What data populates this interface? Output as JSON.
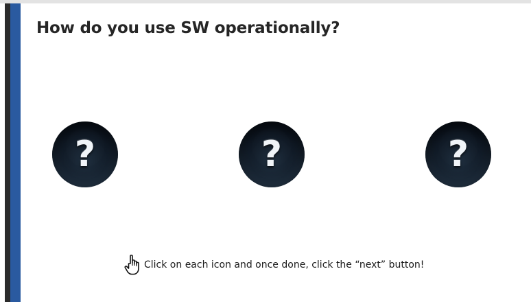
{
  "slide": {
    "title": "How do you use SW operationally?",
    "icons": [
      {
        "symbol": "?",
        "icon": "question-icon"
      },
      {
        "symbol": "?",
        "icon": "question-icon"
      },
      {
        "symbol": "?",
        "icon": "question-icon"
      }
    ],
    "instruction": "Click on each icon and once done, click the “next” button!",
    "instruction_icon": "pointing-hand-icon"
  },
  "colors": {
    "accent_bar": "#2a5aa0",
    "dark_bar": "#2b2b2b",
    "icon_bg": "#0b1320",
    "title_text": "#262626"
  }
}
